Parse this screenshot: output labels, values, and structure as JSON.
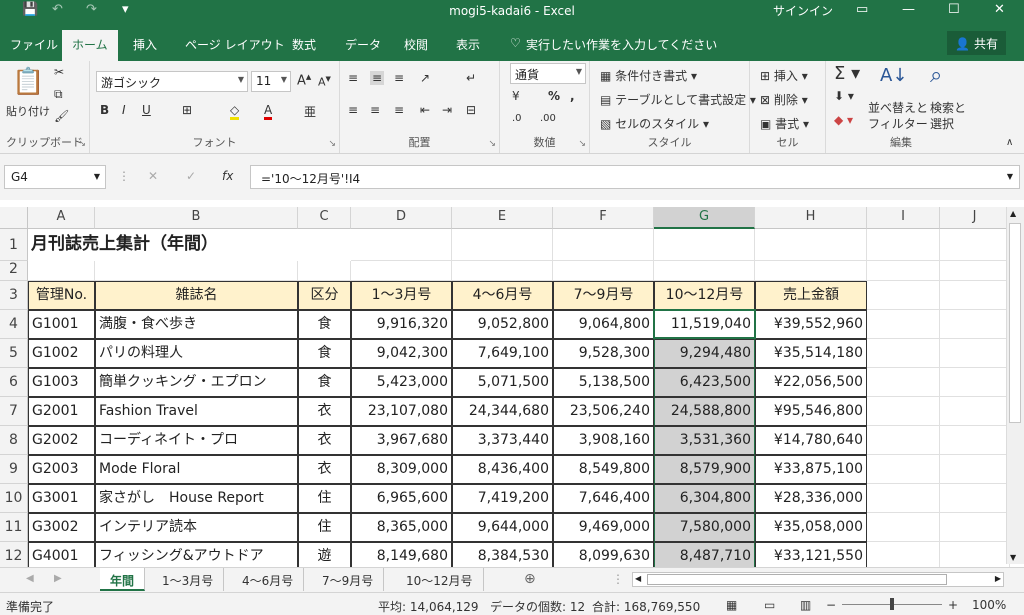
{
  "window": {
    "title": "mogi5-kadai6  -  Excel",
    "signin": "サインイン"
  },
  "menu": {
    "tabs": [
      "ファイル",
      "ホーム",
      "挿入",
      "ページ レイアウト",
      "数式",
      "データ",
      "校閲",
      "表示"
    ],
    "tell_me": "実行したい作業を入力してください",
    "share": "共有"
  },
  "ribbon": {
    "paste": "貼り付け",
    "clipboard": "クリップボード",
    "font_name": "游ゴシック",
    "font_size": "11",
    "font_group": "フォント",
    "align_group": "配置",
    "number_format": "通貨",
    "number_group": "数値",
    "cond_format": "条件付き書式",
    "table_format": "テーブルとして書式設定",
    "cell_style": "セルのスタイル",
    "style_group": "スタイル",
    "insert": "挿入",
    "delete": "削除",
    "format": "書式",
    "cells_group": "セル",
    "sort_filter_1": "並べ替えと",
    "sort_filter_2": "フィルター",
    "find_1": "検索と",
    "find_2": "選択",
    "edit_group": "編集"
  },
  "formula": {
    "name_box": "G4",
    "fx": "fx",
    "content": "='10～12月号'!I4"
  },
  "grid": {
    "columns": [
      "A",
      "B",
      "C",
      "D",
      "E",
      "F",
      "G",
      "H",
      "I",
      "J"
    ],
    "rows": [
      "1",
      "2",
      "3",
      "4",
      "5",
      "6",
      "7",
      "8",
      "9",
      "10",
      "11",
      "12"
    ],
    "title": "月刊誌売上集計（年間）",
    "headers": [
      "管理No.",
      "雑誌名",
      "区分",
      "1～3月号",
      "4～6月号",
      "7～9月号",
      "10～12月号",
      "売上金額"
    ],
    "data": [
      [
        "G1001",
        "満腹・食べ歩き",
        "食",
        "9,916,320",
        "9,052,800",
        "9,064,800",
        "11,519,040",
        "¥39,552,960"
      ],
      [
        "G1002",
        "パリの料理人",
        "食",
        "9,042,300",
        "7,649,100",
        "9,528,300",
        "9,294,480",
        "¥35,514,180"
      ],
      [
        "G1003",
        "簡単クッキング・エプロン",
        "食",
        "5,423,000",
        "5,071,500",
        "5,138,500",
        "6,423,500",
        "¥22,056,500"
      ],
      [
        "G2001",
        "Fashion Travel",
        "衣",
        "23,107,080",
        "24,344,680",
        "23,506,240",
        "24,588,800",
        "¥95,546,800"
      ],
      [
        "G2002",
        "コーディネイト・プロ",
        "衣",
        "3,967,680",
        "3,373,440",
        "3,908,160",
        "3,531,360",
        "¥14,780,640"
      ],
      [
        "G2003",
        "Mode Floral",
        "衣",
        "8,309,000",
        "8,436,400",
        "8,549,800",
        "8,579,900",
        "¥33,875,100"
      ],
      [
        "G3001",
        "家さがし　House Report",
        "住",
        "6,965,600",
        "7,419,200",
        "7,646,400",
        "6,304,800",
        "¥28,336,000"
      ],
      [
        "G3002",
        "インテリア読本",
        "住",
        "8,365,000",
        "9,644,000",
        "9,469,000",
        "7,580,000",
        "¥35,058,000"
      ],
      [
        "G4001",
        "フィッシング&アウトドア",
        "遊",
        "8,149,680",
        "8,384,530",
        "8,099,630",
        "8,487,710",
        "¥33,121,550"
      ]
    ]
  },
  "sheets": [
    "年間",
    "1～3月号",
    "4～6月号",
    "7～9月号",
    "10～12月号"
  ],
  "status": {
    "ready": "準備完了",
    "average": "平均: 14,064,129",
    "count": "データの個数: 12",
    "sum": "合計: 168,769,550",
    "zoom": "100%"
  }
}
